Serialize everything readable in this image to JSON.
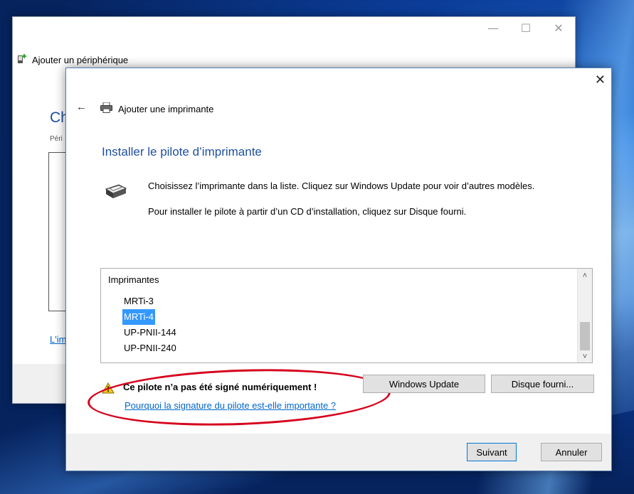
{
  "back_window": {
    "title": "Ajouter un périphérique",
    "heading": "Ch",
    "subtext": "Péri",
    "link": "L'im",
    "controls": {
      "minimize": "—",
      "maximize": "☐",
      "close": "✕"
    }
  },
  "dialog": {
    "title": "Ajouter une imprimante",
    "close": "✕",
    "back": "←",
    "heading": "Installer le pilote d’imprimante",
    "instruction_1": "Choisissez l’imprimante dans la liste. Cliquez sur Windows Update pour voir d’autres modèles.",
    "instruction_2": "Pour installer le pilote à partir d’un CD d’installation, cliquez sur Disque fourni.",
    "list": {
      "header": "Imprimantes",
      "items": [
        "MRTi-3",
        "MRTi-4",
        "UP-PNII-144",
        "UP-PNII-240"
      ],
      "selected": "MRTi-4",
      "scroll_up": "˄",
      "scroll_down": "˅"
    },
    "warning": {
      "text": "Ce pilote n’a pas été signé numériquement !",
      "link": "Pourquoi la signature du pilote est-elle importante ?"
    },
    "buttons": {
      "windows_update": "Windows Update",
      "have_disk": "Disque fourni...",
      "next": "Suivant",
      "cancel": "Annuler"
    }
  },
  "colors": {
    "accent": "#1e4f9e",
    "link": "#0066cc",
    "selection": "#3399ff",
    "annotation": "#d6001c"
  },
  "icons": [
    "add-device-icon",
    "printer-icon",
    "printer-large-icon",
    "warning-icon",
    "back-arrow-icon",
    "close-icon"
  ]
}
